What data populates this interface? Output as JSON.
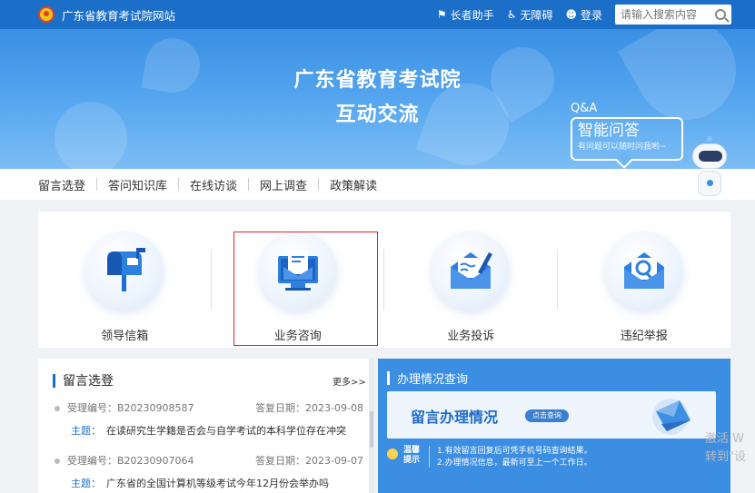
{
  "topbar": {
    "site_name": "广东省教育考试院网站",
    "elder_label": "长者助手",
    "access_label": "无障碍",
    "login_label": "登录",
    "search_placeholder": "请输入搜索内容"
  },
  "banner": {
    "title_line1": "广东省教育考试院",
    "title_line2": "互动交流",
    "qa_tag": "Q&A",
    "qa_main": "智能问答",
    "qa_sub": "有问题可以随时问我哟~"
  },
  "nav": {
    "items": [
      "留言选登",
      "答问知识库",
      "在线访谈",
      "网上调查",
      "政策解读"
    ]
  },
  "services": {
    "items": [
      {
        "label": "领导信箱",
        "icon": "mailbox-icon"
      },
      {
        "label": "业务咨询",
        "icon": "computer-mail-icon"
      },
      {
        "label": "业务投诉",
        "icon": "pen-envelope-icon"
      },
      {
        "label": "违纪举报",
        "icon": "magnifier-envelope-icon"
      }
    ],
    "selected_index": 1,
    "selected_color": "#e0262b"
  },
  "messages": {
    "title": "留言选登",
    "more": "更多>>",
    "items": [
      {
        "id": "受理编号：B20230908587",
        "date": "答复日期：2023-09-08",
        "subject_label": "主题：",
        "subject": "在读研究生学籍是否会与自学考试的本科学位存在冲突"
      },
      {
        "id": "受理编号：B20230907064",
        "date": "答复日期：2023-09-07",
        "subject_label": "主题：",
        "subject": "广东省的全国计算机等级考试今年12月份会举办吗"
      }
    ]
  },
  "status": {
    "title": "办理情况查询",
    "card_title": "留言办理情况",
    "card_button": "点击查询",
    "tip_label_1": "温馨",
    "tip_label_2": "提示",
    "tip_1": "1.有效留言回复后可凭手机号码查询结果。",
    "tip_2": "2.办理情况信息，最新可至上一个工作日。"
  },
  "watermark": {
    "line1": "激活 W",
    "line2": "转到\"设"
  },
  "colors": {
    "brand": "#1c6fc9",
    "panel_blue": "#3c8ee3",
    "page_bg": "#f0f2f5"
  }
}
